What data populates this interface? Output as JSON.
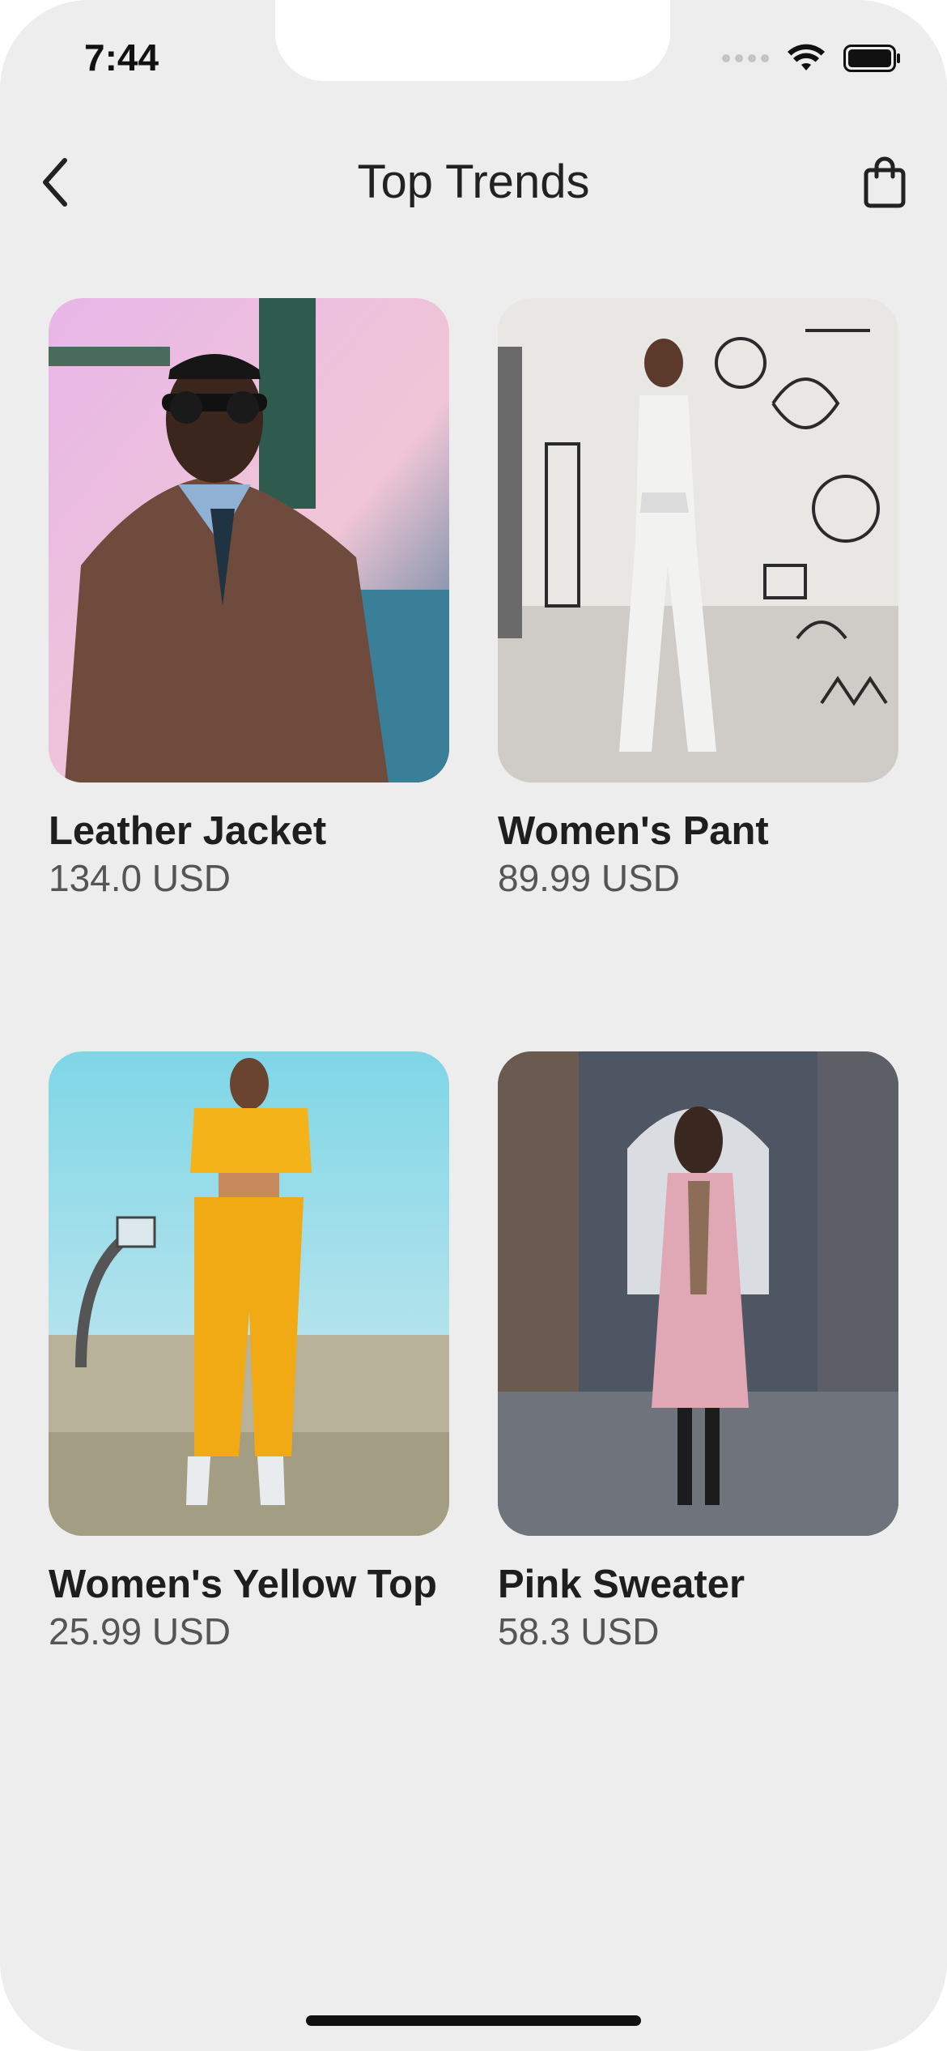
{
  "status_bar": {
    "time": "7:44"
  },
  "nav": {
    "title": "Top Trends"
  },
  "products": [
    {
      "name": "Leather Jacket",
      "price": "134.0 USD"
    },
    {
      "name": "Women's Pant",
      "price": "89.99 USD"
    },
    {
      "name": "Women's Yellow Top",
      "price": "25.99 USD"
    },
    {
      "name": "Pink Sweater",
      "price": "58.3 USD"
    }
  ],
  "colors": {
    "background": "#ededed",
    "title": "#222222",
    "price": "#555555"
  },
  "icons": {
    "back": "chevron-left-icon",
    "cart": "shopping-bag-icon",
    "wifi": "wifi-icon",
    "battery": "battery-icon"
  }
}
